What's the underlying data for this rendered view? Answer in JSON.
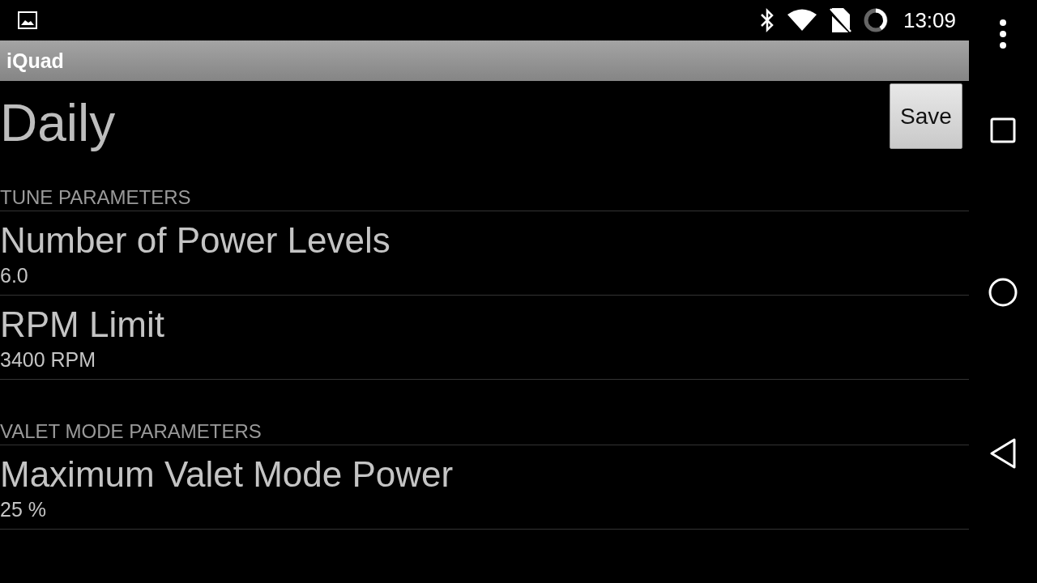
{
  "status_bar": {
    "time": "13:09"
  },
  "action_bar": {
    "title": "iQuad"
  },
  "page": {
    "title": "Daily",
    "save_button": "Save"
  },
  "sections": [
    {
      "header": "TUNE PARAMETERS",
      "items": [
        {
          "title": "Number of Power Levels",
          "value": "6.0"
        },
        {
          "title": "RPM Limit",
          "value": "3400 RPM"
        }
      ]
    },
    {
      "header": "VALET MODE PARAMETERS",
      "items": [
        {
          "title": "Maximum Valet Mode Power",
          "value": "25 %"
        }
      ]
    }
  ]
}
